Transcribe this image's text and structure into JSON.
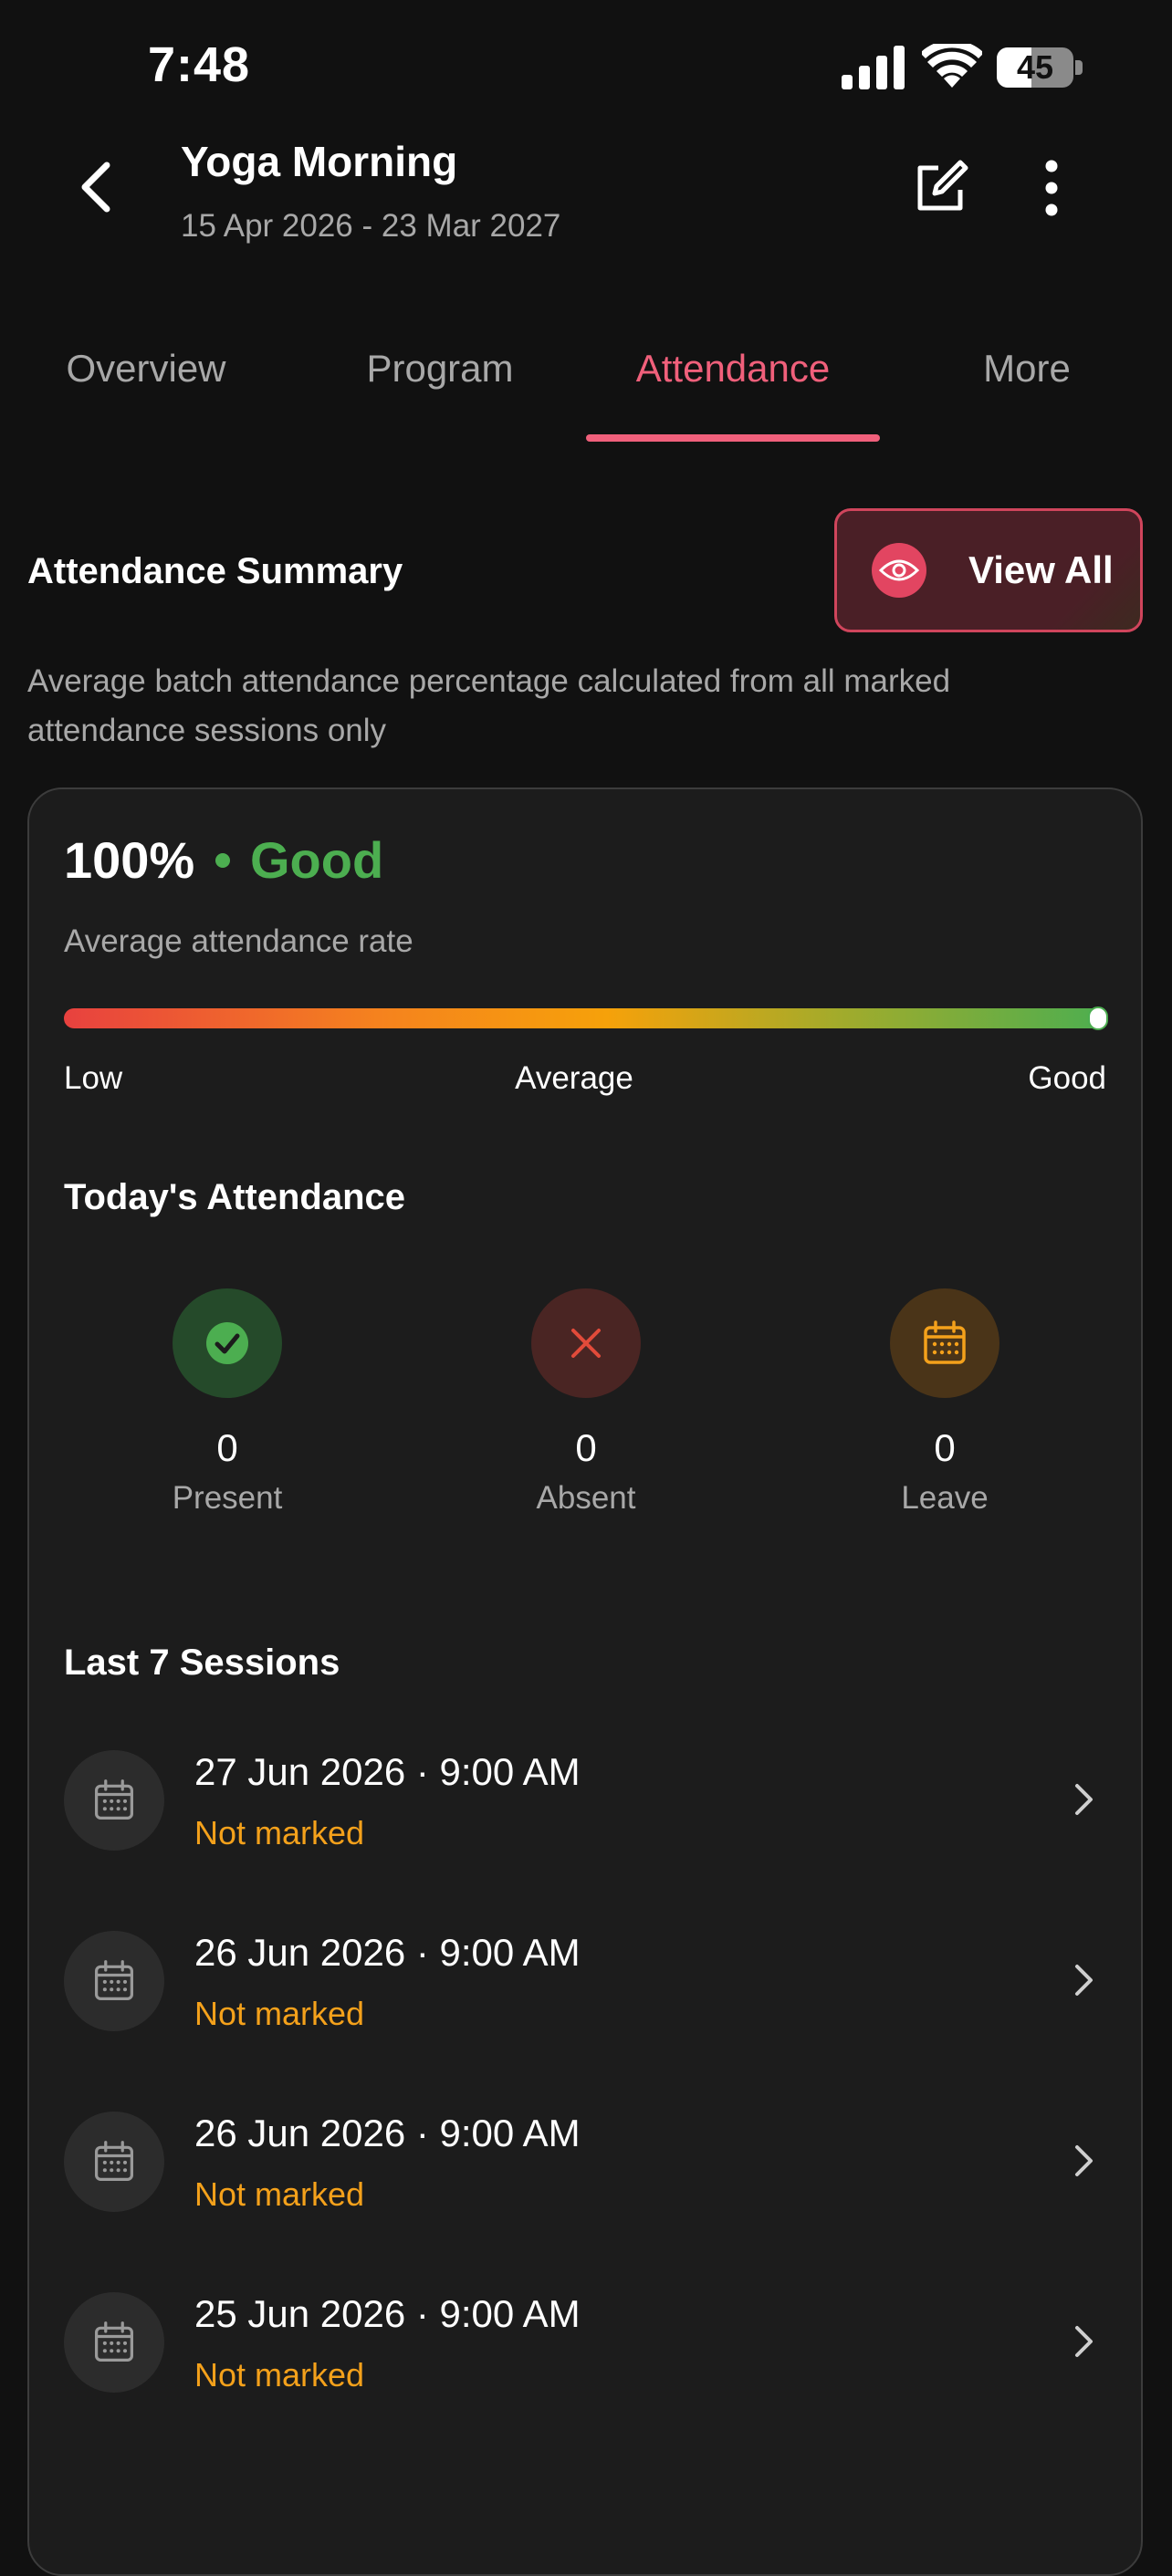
{
  "status_bar": {
    "time": "7:48",
    "battery": "45",
    "battery_level": 0.45
  },
  "header": {
    "title": "Yoga Morning",
    "subtitle": "15 Apr 2026 - 23 Mar 2027"
  },
  "tabs": [
    {
      "label": "Overview",
      "active": false
    },
    {
      "label": "Program",
      "active": false
    },
    {
      "label": "Attendance",
      "active": true
    },
    {
      "label": "More",
      "active": false
    }
  ],
  "summary": {
    "title": "Attendance Summary",
    "view_all_label": "View All",
    "description": "Average batch attendance percentage calculated from all marked attendance sessions only"
  },
  "rate": {
    "percent": "100%",
    "status": "Good",
    "label": "Average attendance rate",
    "level": 1.0,
    "scale_low": "Low",
    "scale_mid": "Average",
    "scale_high": "Good"
  },
  "today": {
    "title": "Today's Attendance",
    "stats": [
      {
        "value": "0",
        "label": "Present",
        "icon": "check-icon",
        "color": "#4cae50"
      },
      {
        "value": "0",
        "label": "Absent",
        "icon": "close-icon",
        "color": "#e24b3a"
      },
      {
        "value": "0",
        "label": "Leave",
        "icon": "calendar-icon",
        "color": "#f4a11b"
      }
    ]
  },
  "sessions": {
    "title": "Last 7 Sessions",
    "items": [
      {
        "date": "27 Jun 2026 · 9:00 AM",
        "status": "Not marked"
      },
      {
        "date": "26 Jun 2026 · 9:00 AM",
        "status": "Not marked"
      },
      {
        "date": "26 Jun 2026 · 9:00 AM",
        "status": "Not marked"
      },
      {
        "date": "25 Jun 2026 · 9:00 AM",
        "status": "Not marked"
      }
    ]
  },
  "colors": {
    "accent": "#f0607b",
    "good": "#4cae50",
    "warning": "#f4a11b",
    "background": "#111111",
    "card": "#1c1c1c"
  }
}
